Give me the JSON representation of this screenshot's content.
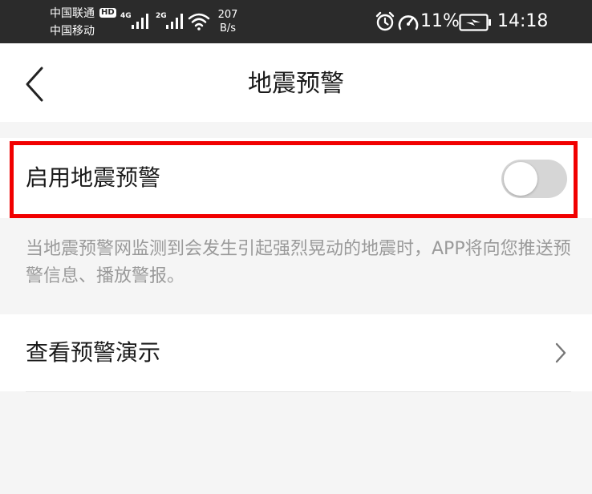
{
  "status_bar": {
    "carrier_1": "中国联通",
    "carrier_2": "中国移动",
    "hd_badge": "HD",
    "network_1": "4G",
    "network_2": "2G",
    "speed_value": "207",
    "speed_unit": "B/s",
    "battery_percent": "11%",
    "time": "14:18",
    "icons": [
      "signal-icon",
      "wifi-icon",
      "alarm-icon",
      "speedometer-icon",
      "battery-charging-icon"
    ]
  },
  "nav": {
    "title": "地震预警",
    "back_icon": "chevron-left-icon"
  },
  "settings": {
    "enable_label": "启用地震预警",
    "enable_toggle_on": false,
    "highlight_color": "#f10000",
    "description": "当地震预警网监测到会发生引起强烈晃动的地震时，APP将向您推送预警信息、播放警报。",
    "demo_label": "查看预警演示",
    "demo_icon": "chevron-right-icon"
  }
}
